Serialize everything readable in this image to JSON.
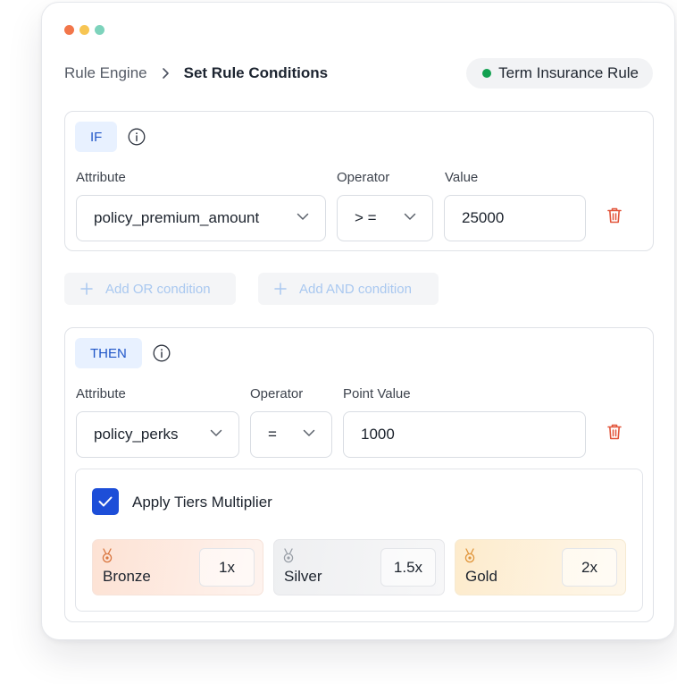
{
  "window": {
    "controls": [
      "close",
      "minimize",
      "maximize"
    ],
    "control_colors": {
      "close": "#f2764a",
      "minimize": "#f7c553",
      "maximize": "#7dd3bc"
    }
  },
  "breadcrumb": {
    "root": "Rule Engine",
    "current": "Set Rule Conditions"
  },
  "rule": {
    "name": "Term Insurance Rule",
    "status_color": "#12a150"
  },
  "if_block": {
    "tag": "IF",
    "attribute_label": "Attribute",
    "operator_label": "Operator",
    "value_label": "Value",
    "attribute_value": "policy_premium_amount",
    "operator_value": "> =",
    "value_value": "25000"
  },
  "actions": {
    "add_or": "Add OR condition",
    "add_and": "Add AND condition"
  },
  "then_block": {
    "tag": "THEN",
    "attribute_label": "Attribute",
    "operator_label": "Operator",
    "point_value_label": "Point Value",
    "attribute_value": "policy_perks",
    "operator_value": "=",
    "point_value": "1000"
  },
  "tiers": {
    "checkbox_label": "Apply Tiers Multiplier",
    "checked": true,
    "items": [
      {
        "name": "Bronze",
        "multiplier": "1x",
        "icon": "medal-icon"
      },
      {
        "name": "Silver",
        "multiplier": "1.5x",
        "icon": "medal-icon"
      },
      {
        "name": "Gold",
        "multiplier": "2x",
        "icon": "medal-icon"
      }
    ]
  },
  "colors": {
    "accent": "#2157c8",
    "checkbox": "#1d4ed8",
    "delete": "#e2553b",
    "add_text": "#a9c8f0"
  }
}
